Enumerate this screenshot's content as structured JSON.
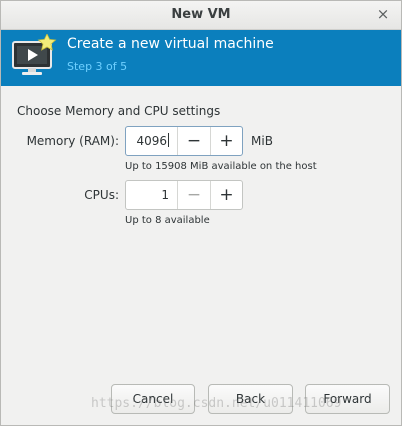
{
  "window": {
    "title": "New VM",
    "close_glyph": "×"
  },
  "banner": {
    "title": "Create a new virtual machine",
    "step": "Step 3 of 5",
    "icon": "vm-monitor-icon",
    "bg_color": "#0b7fbd",
    "step_color": "#6fd0ff"
  },
  "settings": {
    "section_title": "Choose Memory and CPU settings",
    "memory": {
      "label": "Memory (RAM):",
      "value": "4096",
      "unit": "MiB",
      "hint": "Up to 15908 MiB available on the host",
      "minus": "−",
      "plus": "+"
    },
    "cpus": {
      "label": "CPUs:",
      "value": "1",
      "hint": "Up to 8 available",
      "minus": "−",
      "plus": "+"
    }
  },
  "footer": {
    "cancel_label": "Cancel",
    "back_label": "Back",
    "forward_label": "Forward"
  },
  "watermark": "https://blog.csdn.net/u011411069"
}
